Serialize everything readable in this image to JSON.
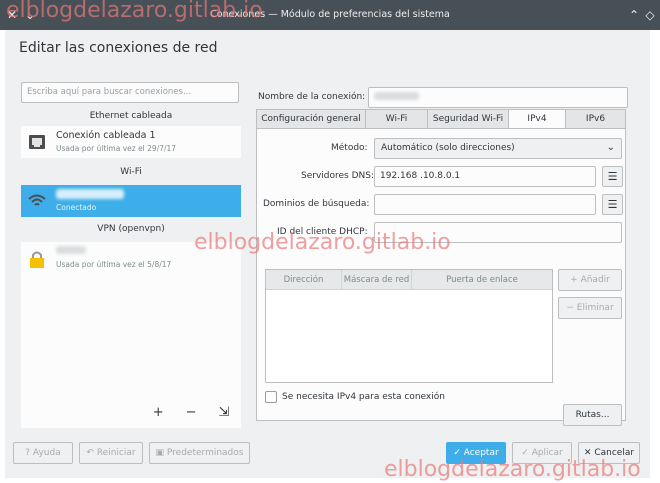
{
  "window": {
    "title": "Conexiones — Módulo de preferencias del sistema",
    "heading": "Editar las conexiones de red"
  },
  "left": {
    "search_placeholder": "Escriba aquí para buscar conexiones...",
    "groups": {
      "ethernet": "Ethernet cableada",
      "wifi": "Wi-Fi",
      "vpn": "VPN (openvpn)"
    },
    "ethernet_conn": {
      "name": "Conexión cableada 1",
      "sub": "Usada por última vez el 29/7/17"
    },
    "wifi_conn": {
      "sub": "Conectado"
    },
    "vpn_conn": {
      "sub": "Usada por última vez el 5/8/17"
    },
    "actions": {
      "add": "+",
      "remove": "−",
      "export": "⇲"
    }
  },
  "right": {
    "conn_name_label": "Nombre de la conexión:",
    "tabs": [
      "Configuración general",
      "Wi-Fi",
      "Seguridad Wi-Fi",
      "IPv4",
      "IPv6"
    ],
    "active_tab": "IPv4",
    "method_label": "Método:",
    "method_value": "Automático (solo direcciones)",
    "dns_label": "Servidores DNS:",
    "dns_value": "192.168 .10.8.0.1",
    "search_domains_label": "Dominios de búsqueda:",
    "dhcp_client_label": "ID del cliente DHCP:",
    "table_headers": [
      "Dirección",
      "Máscara de red",
      "Puerta de enlace"
    ],
    "add_button": "Añadir",
    "remove_button": "Eliminar",
    "require_ipv4_label": "Se necesita IPv4 para esta conexión",
    "routes_button": "Rutas..."
  },
  "bottom": {
    "help": "Ayuda",
    "reset": "Reiniciar",
    "defaults": "Predeterminados",
    "ok": "Aceptar",
    "apply": "Aplicar",
    "cancel": "Cancelar"
  },
  "watermark": "elblogdelazaro.gitlab.io",
  "colors": {
    "accent": "#3daee9",
    "titlebar": "#475057",
    "window_bg": "#eff0f1"
  }
}
